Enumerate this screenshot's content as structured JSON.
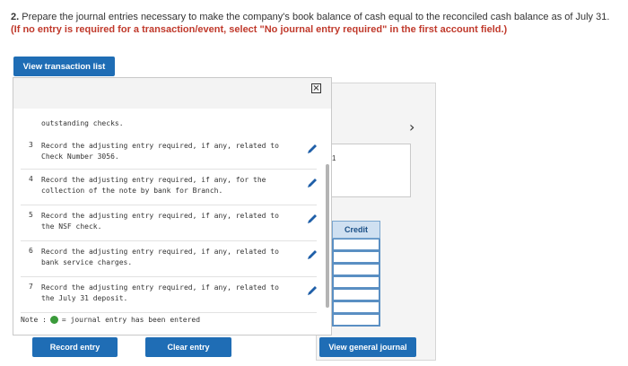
{
  "question": {
    "number": "2.",
    "text": "Prepare the journal entries necessary to make the company's book balance of cash equal to the reconciled cash balance as of July 31.",
    "note": "(If no entry is required for a transaction/event, select \"No journal entry required\" in the first account field.)"
  },
  "buttons": {
    "view_transaction_list": "View transaction list",
    "record_entry": "Record entry",
    "clear_entry": "Clear entry",
    "view_general_journal": "View general journal"
  },
  "popup": {
    "close_glyph": "×",
    "cut_text": "outstanding checks.",
    "items": [
      {
        "number": "3",
        "text": "Record the adjusting entry required, if any, related to Check Number 3056."
      },
      {
        "number": "4",
        "text": "Record the adjusting entry required, if any, for the collection of the note by bank for Branch."
      },
      {
        "number": "5",
        "text": "Record the adjusting entry required, if any, related to the NSF check."
      },
      {
        "number": "6",
        "text": "Record the adjusting entry required, if any, related to bank service charges."
      },
      {
        "number": "7",
        "text": "Record the adjusting entry required, if any, related to the July 31 deposit."
      }
    ],
    "note_label": "Note :",
    "note_text": "= journal entry has been entered"
  },
  "background": {
    "chevron": "›",
    "glyph": "1",
    "credit_header": "Credit"
  },
  "colors": {
    "button_blue": "#1f6db5",
    "note_red": "#c0392b",
    "entered_green": "#3a9a3a",
    "pencil_blue": "#1f5fa8"
  }
}
